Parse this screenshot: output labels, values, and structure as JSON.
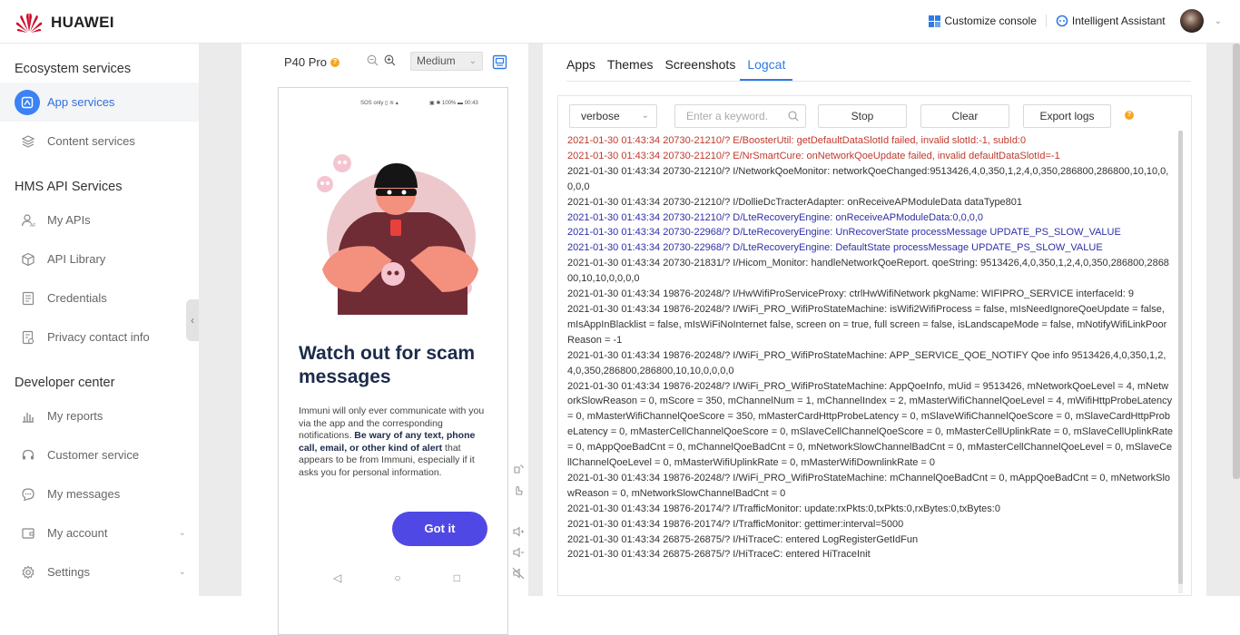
{
  "brand": {
    "name": "HUAWEI"
  },
  "topbar": {
    "customize_label": "Customize console",
    "assistant_label": "Intelligent Assistant"
  },
  "sidebar": {
    "sections": [
      {
        "title": "Ecosystem services"
      },
      {
        "title": "HMS API Services"
      },
      {
        "title": "Developer center"
      }
    ],
    "items": [
      {
        "label": "App services",
        "icon": "app-services-icon",
        "active": true
      },
      {
        "label": "Content services",
        "icon": "layers-icon"
      },
      {
        "label": "My APIs",
        "icon": "api-user-icon"
      },
      {
        "label": "API Library",
        "icon": "cube-icon"
      },
      {
        "label": "Credentials",
        "icon": "document-icon"
      },
      {
        "label": "Privacy contact info",
        "icon": "privacy-doc-icon"
      },
      {
        "label": "My reports",
        "icon": "bar-chart-icon"
      },
      {
        "label": "Customer service",
        "icon": "headset-icon"
      },
      {
        "label": "My messages",
        "icon": "chat-bubble-icon"
      },
      {
        "label": "My account",
        "icon": "wallet-icon"
      },
      {
        "label": "Settings",
        "icon": "gear-icon"
      }
    ]
  },
  "device": {
    "model": "P40 Pro",
    "quality": "Medium",
    "status_left": "SOS only",
    "status_right": "100%",
    "status_time": "00:43",
    "title": "Watch out for scam messages",
    "body_plain_1": "Immuni will only ever communicate with you via the app and the corresponding notifications. ",
    "body_bold": "Be wary of any text, phone call, email, or other kind of alert",
    "body_plain_2": " that appears to be from Immuni, especially if it asks you for personal information.",
    "button": "Got it"
  },
  "tabs": [
    {
      "label": "Apps"
    },
    {
      "label": "Themes"
    },
    {
      "label": "Screenshots"
    },
    {
      "label": "Logcat",
      "active": true
    }
  ],
  "logcat": {
    "level": "verbose",
    "search_placeholder": "Enter a keyword.",
    "stop": "Stop",
    "clear": "Clear",
    "export": "Export logs",
    "colors": {
      "error": "#c0392b",
      "debug": "#2f2fa8",
      "info": "#333333"
    },
    "lines": [
      {
        "level": "error",
        "text": "2021-01-30 01:43:34 20730-21210/? E/BoosterUtil: getDefaultDataSlotId failed, invalid slotId:-1, subId:0"
      },
      {
        "level": "error",
        "text": "2021-01-30 01:43:34 20730-21210/? E/NrSmartCure: onNetworkQoeUpdate failed, invalid defaultDataSlotId=-1"
      },
      {
        "level": "info",
        "text": "2021-01-30 01:43:34 20730-21210/? I/NetworkQoeMonitor: networkQoeChanged:9513426,4,0,350,1,2,4,0,350,286800,286800,10,10,0,0,0,0"
      },
      {
        "level": "info",
        "text": "2021-01-30 01:43:34 20730-21210/? I/DollieDcTracterAdapter: onReceiveAPModuleData dataType801"
      },
      {
        "level": "debug",
        "text": "2021-01-30 01:43:34 20730-21210/? D/LteRecoveryEngine: onReceiveAPModuleData:0,0,0,0"
      },
      {
        "level": "debug",
        "text": "2021-01-30 01:43:34 20730-22968/? D/LteRecoveryEngine: UnRecoverState processMessage UPDATE_PS_SLOW_VALUE"
      },
      {
        "level": "debug",
        "text": "2021-01-30 01:43:34 20730-22968/? D/LteRecoveryEngine: DefaultState processMessage UPDATE_PS_SLOW_VALUE"
      },
      {
        "level": "info",
        "text": "2021-01-30 01:43:34 20730-21831/? I/Hicom_Monitor: handleNetworkQoeReport. qoeString: 9513426,4,0,350,1,2,4,0,350,286800,286800,10,10,0,0,0,0"
      },
      {
        "level": "info",
        "text": "2021-01-30 01:43:34 19876-20248/? I/HwWifiProServiceProxy: ctrlHwWifiNetwork pkgName: WIFIPRO_SERVICE interfaceId: 9"
      },
      {
        "level": "info",
        "text": "2021-01-30 01:43:34 19876-20248/? I/WiFi_PRO_WifiProStateMachine: isWifi2WifiProcess = false, mIsNeedIgnoreQoeUpdate = false, mIsAppInBlacklist = false, mIsWiFiNoInternet false, screen on = true, full screen = false, isLandscapeMode = false, mNotifyWifiLinkPoorReason = -1"
      },
      {
        "level": "info",
        "text": "2021-01-30 01:43:34 19876-20248/? I/WiFi_PRO_WifiProStateMachine: APP_SERVICE_QOE_NOTIFY Qoe info 9513426,4,0,350,1,2,4,0,350,286800,286800,10,10,0,0,0,0"
      },
      {
        "level": "info",
        "text": "2021-01-30 01:43:34 19876-20248/? I/WiFi_PRO_WifiProStateMachine: AppQoeInfo, mUid = 9513426, mNetworkQoeLevel = 4, mNetworkSlowReason = 0, mScore = 350, mChannelNum = 1, mChannelIndex = 2, mMasterWifiChannelQoeLevel = 4, mWifiHttpProbeLatency = 0, mMasterWifiChannelQoeScore = 350, mMasterCardHttpProbeLatency = 0, mSlaveWifiChannelQoeScore = 0, mSlaveCardHttpProbeLatency = 0, mMasterCellChannelQoeScore = 0, mSlaveCellChannelQoeScore = 0, mMasterCellUplinkRate = 0, mSlaveCellUplinkRate = 0, mAppQoeBadCnt = 0, mChannelQoeBadCnt = 0, mNetworkSlowChannelBadCnt = 0, mMasterCellChannelQoeLevel = 0, mSlaveCellChannelQoeLevel = 0, mMasterWifiUplinkRate = 0, mMasterWifiDownlinkRate = 0"
      },
      {
        "level": "info",
        "text": "2021-01-30 01:43:34 19876-20248/? I/WiFi_PRO_WifiProStateMachine: mChannelQoeBadCnt = 0, mAppQoeBadCnt = 0, mNetworkSlowReason = 0, mNetworkSlowChannelBadCnt = 0"
      },
      {
        "level": "info",
        "text": "2021-01-30 01:43:34 19876-20174/? I/TrafficMonitor: update:rxPkts:0,txPkts:0,rxBytes:0,txBytes:0"
      },
      {
        "level": "info",
        "text": "2021-01-30 01:43:34 19876-20174/? I/TrafficMonitor: gettimer:interval=5000"
      },
      {
        "level": "info",
        "text": "2021-01-30 01:43:34 26875-26875/? I/HiTraceC: entered LogRegisterGetIdFun"
      },
      {
        "level": "info",
        "text": "2021-01-30 01:43:34 26875-26875/? I/HiTraceC: entered HiTraceInit"
      }
    ]
  }
}
